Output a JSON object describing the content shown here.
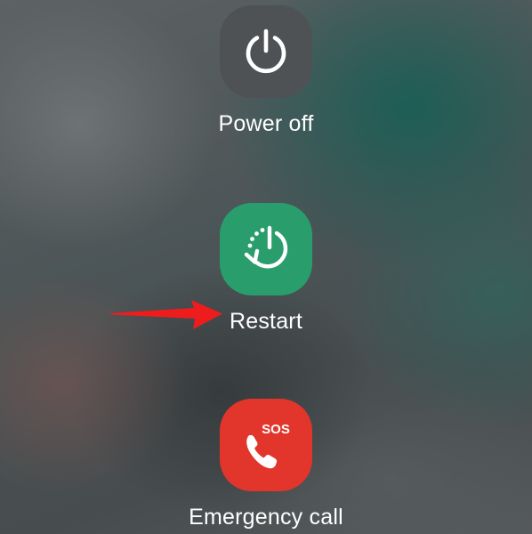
{
  "power_menu": {
    "options": [
      {
        "id": "power_off",
        "label": "Power off",
        "icon": "power-icon",
        "tile_color": "#4f5254"
      },
      {
        "id": "restart",
        "label": "Restart",
        "icon": "restart-icon",
        "tile_color": "#2a9d6c"
      },
      {
        "id": "emergency_call",
        "label": "Emergency call",
        "icon": "sos-phone-icon",
        "tile_color": "#e2352b",
        "badge": "SOS"
      }
    ]
  },
  "annotation": {
    "icon": "red-arrow-icon",
    "color": "#ee1c1c",
    "points_to": "restart"
  }
}
